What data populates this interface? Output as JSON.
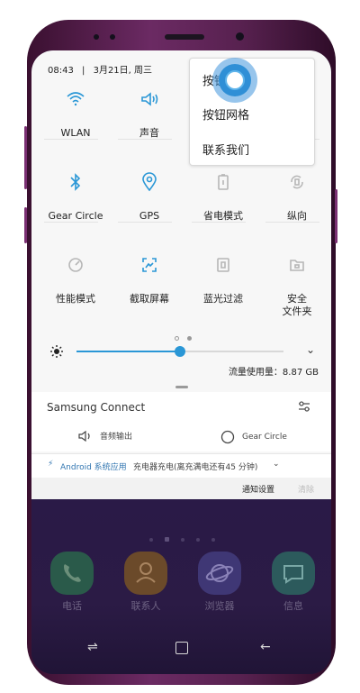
{
  "status": {
    "time": "08:43",
    "date": "3月21日, 周三"
  },
  "tiles": [
    {
      "label": "WLAN",
      "icon": "wifi-icon",
      "active": true
    },
    {
      "label": "声音",
      "icon": "speaker-icon",
      "active": true
    },
    {
      "label": "Gear Circle",
      "icon": "bluetooth-icon",
      "active": true
    },
    {
      "label": "GPS",
      "icon": "location-icon",
      "active": true
    },
    {
      "label": "省电模式",
      "icon": "battery-saver-icon",
      "active": false
    },
    {
      "label": "纵向",
      "icon": "rotate-icon",
      "active": false
    },
    {
      "label": "性能模式",
      "icon": "performance-icon",
      "active": false
    },
    {
      "label": "截取屏幕",
      "icon": "screenshot-icon",
      "active": true
    },
    {
      "label": "蓝光过滤",
      "icon": "blue-light-filter-icon",
      "active": false
    },
    {
      "label": "安全\n文件夹",
      "icon": "secure-folder-icon",
      "active": false
    }
  ],
  "brightness": {
    "level": 0.5,
    "icon": "brightness-icon"
  },
  "usage": "流量使用量：8.87 GB",
  "samsung_connect": {
    "title": "Samsung Connect",
    "audio_output": "音频输出",
    "gear_circle": "Gear Circle"
  },
  "notification": {
    "app": "Android 系统应用",
    "text": "充电器充电(离充满电还有45 分钟)"
  },
  "notif_footer": {
    "settings": "通知设置",
    "clear": "清除"
  },
  "popup_menu": [
    "按钮顺序",
    "按钮网格",
    "联系我们"
  ],
  "home_apps": [
    {
      "label": "电话",
      "icon": "phone-icon",
      "color": "#2f8a5a"
    },
    {
      "label": "联系人",
      "icon": "contacts-icon",
      "color": "#b86a2a"
    },
    {
      "label": "浏览器",
      "icon": "browser-icon",
      "color": "#5a4bb5"
    },
    {
      "label": "信息",
      "icon": "messages-icon",
      "color": "#2e8a86"
    }
  ],
  "colors": {
    "accent": "#2a97d6",
    "phone_frame": "#6b2a63"
  }
}
